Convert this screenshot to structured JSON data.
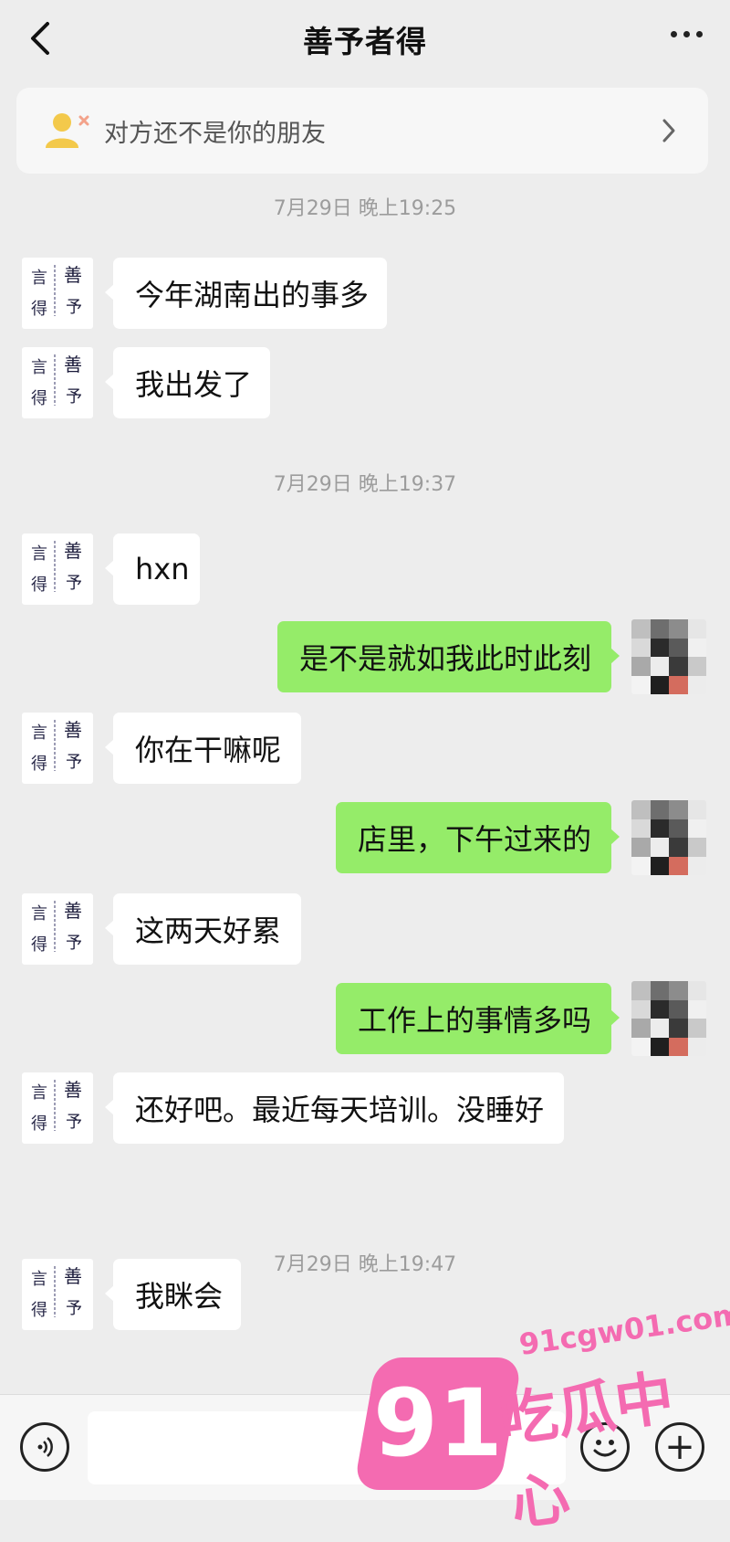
{
  "header": {
    "title": "善予者得",
    "back_icon": "chevron-left-icon",
    "more_icon": "more-horizontal-icon"
  },
  "notice": {
    "text": "对方还不是你的朋友",
    "icon": "user-not-friend-icon"
  },
  "timestamps": [
    "7月29日 晚上19:25",
    "7月29日 晚上19:37",
    "7月29日 晚上19:47"
  ],
  "messages": [
    {
      "side": "left",
      "text": "今年湖南出的事多"
    },
    {
      "side": "left",
      "text": "我出发了"
    },
    {
      "side": "left",
      "text": "hxn"
    },
    {
      "side": "right",
      "text": "是不是就如我此时此刻"
    },
    {
      "side": "left",
      "text": "你在干嘛呢"
    },
    {
      "side": "right",
      "text": "店里，下午过来的"
    },
    {
      "side": "left",
      "text": "这两天好累"
    },
    {
      "side": "right",
      "text": "工作上的事情多吗"
    },
    {
      "side": "left",
      "text": "还好吧。最近每天培训。没睡好"
    },
    {
      "side": "left",
      "text": "我眯会"
    }
  ],
  "input_bar": {
    "voice_icon": "voice-icon",
    "emoji_icon": "emoji-icon",
    "plus_icon": "plus-icon"
  },
  "watermark": {
    "number": "91",
    "site": "91cgw01.com",
    "name": "吃瓜中心"
  },
  "colors": {
    "background": "#ededed",
    "bubble_self": "#95ec69",
    "bubble_other": "#ffffff",
    "watermark": "#f46bb1"
  }
}
